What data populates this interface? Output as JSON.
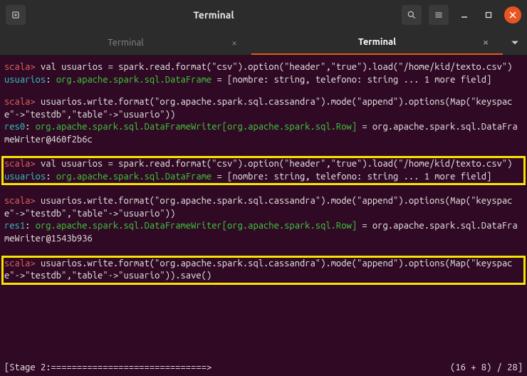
{
  "titlebar": {
    "title": "Terminal"
  },
  "tabs": [
    {
      "label": "Terminal",
      "active": false
    },
    {
      "label": "Terminal",
      "active": true
    }
  ],
  "blocks": {
    "b1_prompt": "scala>",
    "b1_cmd": " val usuarios = spark.read.format(\"csv\").option(\"header\",\"true\").load(\"/home/kid/texto.csv\")",
    "b1_res_var": "usuarios",
    "b1_res_type": "org.apache.spark.sql.DataFrame",
    "b1_res_rest": " = [nombre: string, telefono: string ... 1 more field]",
    "b2_prompt": "scala>",
    "b2_cmd": " usuarios.write.format(\"org.apache.spark.sql.cassandra\").mode(\"append\").options(Map(\"keyspace\"->\"testdb\",\"table\"->\"usuario\"))",
    "b2_res_var": "res0",
    "b2_res_type": "org.apache.spark.sql.DataFrameWriter[org.apache.spark.sql.Row]",
    "b2_res_rest": " = org.apache.spark.sql.DataFrameWriter@460f2b6c",
    "b3_prompt": "scala>",
    "b3_cmd": " val usuarios = spark.read.format(\"csv\").option(\"header\",\"true\").load(\"/home/kid/texto.csv\")",
    "b3_res_var": "usuarios",
    "b3_res_type": "org.apache.spark.sql.DataFrame",
    "b3_res_rest": " = [nombre: string, telefono: string ... 1 more field]",
    "b4_prompt": "scala>",
    "b4_cmd": " usuarios.write.format(\"org.apache.spark.sql.cassandra\").mode(\"append\").options(Map(\"keyspace\"->\"testdb\",\"table\"->\"usuario\"))",
    "b4_res_var": "res1",
    "b4_res_type": "org.apache.spark.sql.DataFrameWriter[org.apache.spark.sql.Row]",
    "b4_res_rest": " = org.apache.spark.sql.DataFrameWriter@1543b936",
    "b5_prompt": "scala>",
    "b5_cmd": " usuarios.write.format(\"org.apache.spark.sql.cassandra\").mode(\"append\").options(Map(\"keyspace\"->\"testdb\",\"table\"->\"usuario\")).save()"
  },
  "status": {
    "stage": "[Stage 2:==============================>",
    "progress": "(16 + 8) / 28]"
  }
}
